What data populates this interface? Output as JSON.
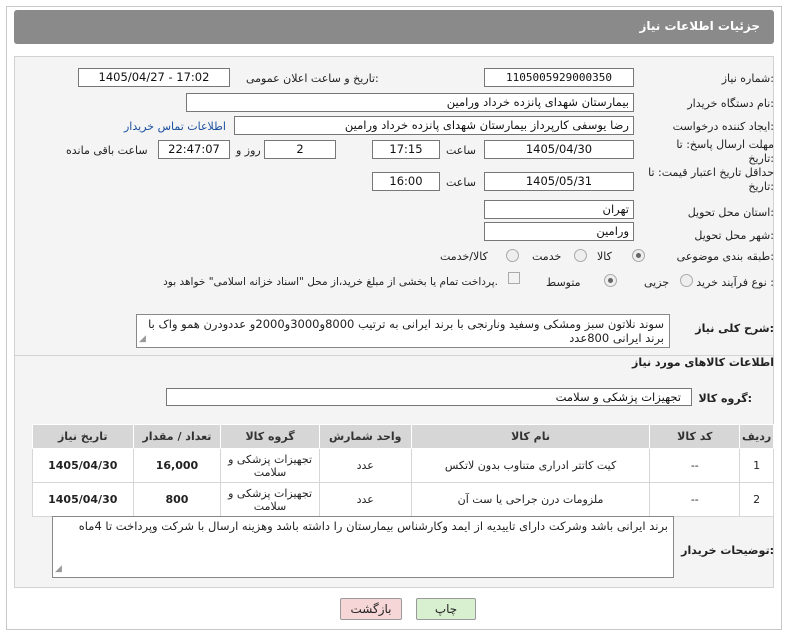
{
  "header": {
    "title": "جزئیات اطلاعات نیاز"
  },
  "fields": {
    "need_number_label": "شماره نیاز:",
    "need_number_value": "1105005929000350",
    "announce_label": "تاریخ و ساعت اعلان عمومی:",
    "announce_value": "1405/04/27 - 17:02",
    "buyer_org_label": "نام دستگاه خریدار:",
    "buyer_org_value": "بیمارستان شهدای پانزده خرداد ورامین",
    "creator_label": "ایجاد کننده درخواست:",
    "creator_value": "رضا یوسفی کارپرداز بیمارستان شهدای پانزده خرداد ورامین",
    "contact_link": "اطلاعات تماس خریدار",
    "deadline_label": "مهلت ارسال پاسخ: تا تاریخ:",
    "deadline_date": "1405/04/30",
    "time_label": "ساعت",
    "deadline_time": "17:15",
    "days_value": "2",
    "days_label": "روز و",
    "remaining_value": "22:47:07",
    "remaining_label": "ساعت باقی مانده",
    "validity_label": "حداقل تاریخ اعتبار قیمت: تا تاریخ:",
    "validity_date": "1405/05/31",
    "validity_time": "16:00",
    "province_label": "استان محل تحویل:",
    "province_value": "تهران",
    "city_label": "شهر محل تحویل:",
    "city_value": "ورامین",
    "category_label": "طبقه بندی موضوعی:",
    "category_options": [
      "کالا",
      "خدمت",
      "کالا/خدمت"
    ],
    "category_selected": "کالا",
    "process_label": "نوع فرآیند خرید :",
    "process_options": [
      "جزیی",
      "متوسط"
    ],
    "process_selected": "متوسط",
    "payment_note": "پرداخت تمام یا بخشی از مبلغ خرید،از محل \"اسناد خزانه اسلامی\" خواهد بود."
  },
  "description": {
    "label": "شرح کلی نیاز:",
    "text": "سوند نلاتون سبز ومشکی وسفید ونارنجی با برند ایرانی به ترتیب 8000و3000و2000و عددودرن همو واک با برند ایرانی 800عدد"
  },
  "goods_section": {
    "title": "اطلاعات کالاهای مورد نیاز",
    "group_label": "گروه کالا:",
    "group_value": "تجهیزات پزشکی و سلامت"
  },
  "table": {
    "headers": [
      "ردیف",
      "کد کالا",
      "نام کالا",
      "واحد شمارش",
      "گروه کالا",
      "تعداد / مقدار",
      "تاریخ نیاز"
    ],
    "rows": [
      {
        "index": "1",
        "code": "--",
        "name": "کیت کاتتر ادراری متناوب بدون لاتکس",
        "unit": "عدد",
        "group": "تجهیزات پزشکی و سلامت",
        "qty": "16,000",
        "date": "1405/04/30"
      },
      {
        "index": "2",
        "code": "--",
        "name": "ملزومات درن جراحی یا ست آن",
        "unit": "عدد",
        "group": "تجهیزات پزشکی و سلامت",
        "qty": "800",
        "date": "1405/04/30"
      }
    ]
  },
  "buyer_notes": {
    "label": "توضیحات خریدار:",
    "text": "برند ایرانی باشد وشرکت دارای تاییدیه از ایمد وکارشناس بیمارستان را داشته باشد وهزینه ارسال با شرکت وپرداخت تا 4ماه"
  },
  "buttons": {
    "print": "چاپ",
    "back": "بازگشت"
  },
  "colors": {
    "header": "#8a8a8a",
    "print_button": "#d8f0d0",
    "back_button": "#f6d6d6",
    "link": "#1a4fa0"
  }
}
